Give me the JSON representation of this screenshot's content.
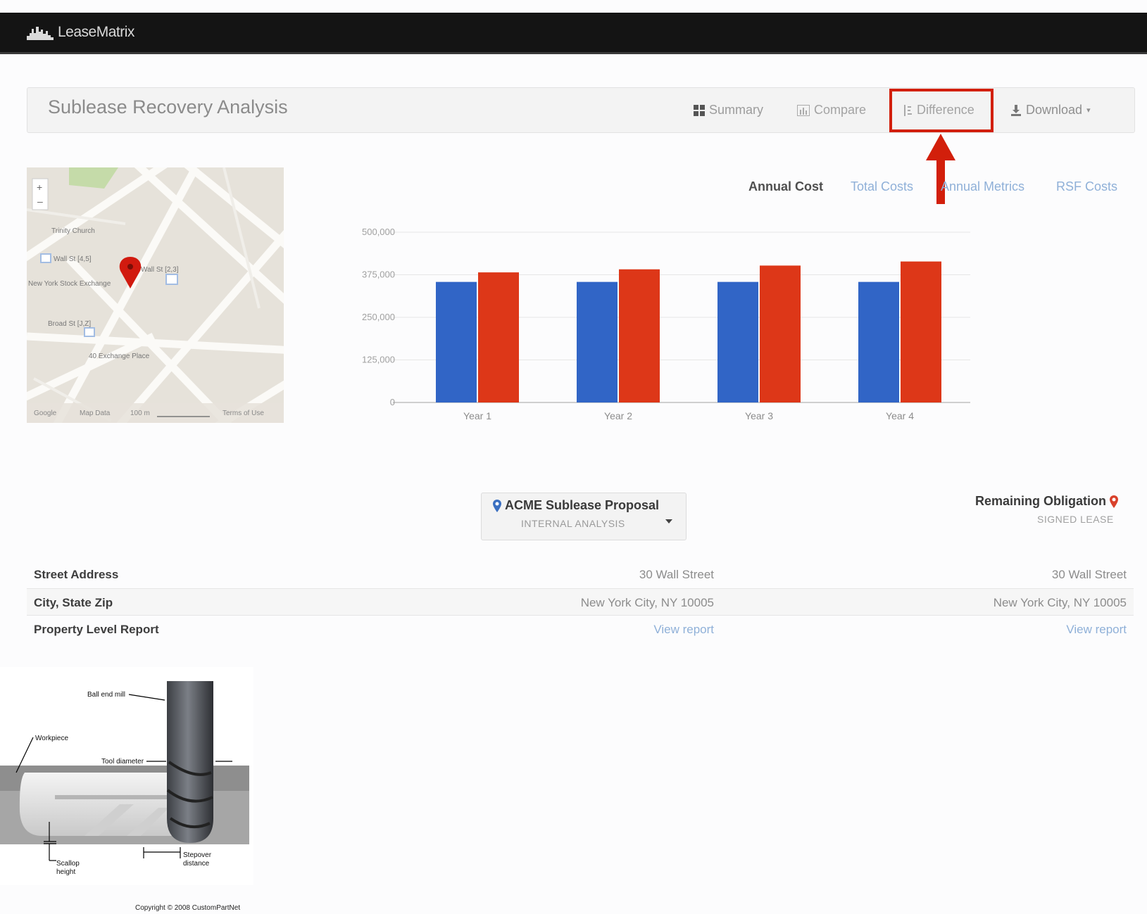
{
  "app": {
    "name": "LeaseMatrix"
  },
  "header": {
    "title": "Sublease Recovery Analysis",
    "tabs": [
      {
        "label": "Summary",
        "icon": "grid-icon"
      },
      {
        "label": "Compare",
        "icon": "bar-chart-icon"
      },
      {
        "label": "Difference",
        "icon": "difference-icon",
        "highlighted": true
      },
      {
        "label": "Download",
        "icon": "download-icon"
      }
    ]
  },
  "chart_tabs": [
    {
      "label": "Annual Cost",
      "active": true
    },
    {
      "label": "Total Costs"
    },
    {
      "label": "Annual Metrics"
    },
    {
      "label": "RSF Costs"
    }
  ],
  "map": {
    "labels": [
      "Trinity Church",
      "Wall St [4,5]",
      "Wall St [2,3]",
      "New York Stock Exchange",
      "Broad St [J,Z]",
      "40 Exchange Place",
      "Google",
      "Map Data",
      "100 m",
      "Terms of Use"
    ]
  },
  "chart_data": {
    "type": "bar",
    "categories": [
      "Year 1",
      "Year 2",
      "Year 3",
      "Year 4"
    ],
    "series": [
      {
        "values": [
          354000,
          354000,
          354000,
          354000
        ],
        "color": "#3165c6"
      },
      {
        "values": [
          382000,
          391000,
          402000,
          414000
        ],
        "color": "#dd3718"
      }
    ],
    "ylim": [
      0,
      500000
    ],
    "yticks": [
      "0",
      "125,000",
      "250,000",
      "375,000",
      "500,000"
    ],
    "grid": true
  },
  "comparison": {
    "proposal": {
      "title": "ACME Sublease Proposal",
      "subtitle": "INTERNAL ANALYSIS"
    },
    "obligation": {
      "title": "Remaining Obligation",
      "subtitle": "SIGNED LEASE"
    },
    "rows": [
      {
        "label": "Street Address",
        "a": "30 Wall Street",
        "b": "30 Wall Street"
      },
      {
        "label": "City, State Zip",
        "a": "New York City, NY 10005",
        "b": "New York City, NY 10005"
      },
      {
        "label": "Property Level Report",
        "a": "View report",
        "b": "View report"
      }
    ]
  },
  "diagram": {
    "labels": {
      "ball_end_mill": "Ball end mill",
      "workpiece": "Workpiece",
      "tool_diameter": "Tool diameter",
      "scallop_1": "Scallop",
      "scallop_2": "height",
      "stepover_1": "Stepover",
      "stepover_2": "distance"
    },
    "copyright": "Copyright © 2008 CustomPartNet"
  },
  "colors": {
    "highlight": "#d21f0b",
    "link": "#8fb0d8",
    "navbar": "#141414"
  }
}
